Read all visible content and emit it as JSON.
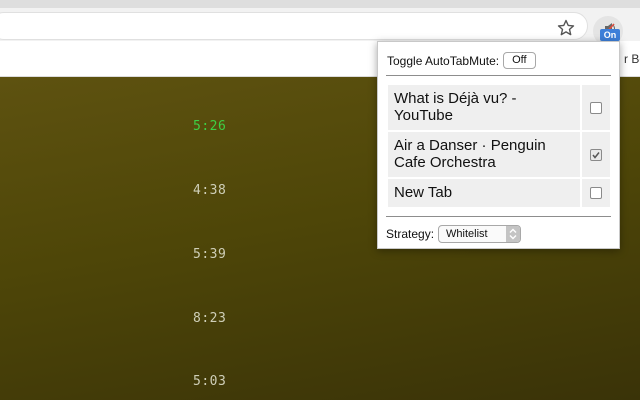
{
  "browser": {
    "bookmark_partial": "r Bo",
    "extension_badge": "On",
    "icons": {
      "star": "star-icon",
      "extension": "muted-speaker-icon"
    }
  },
  "page": {
    "durations": [
      "5:26",
      "4:38",
      "5:39",
      "8:23",
      "5:03"
    ],
    "active_color": "#3ecf44"
  },
  "popup": {
    "toggle_label": "Toggle AutoTabMute:",
    "toggle_button": "Off",
    "tabs": [
      {
        "title": "What is Déjà vu? - YouTube",
        "checked": false
      },
      {
        "title": "Air a Danser · Penguin Cafe Orchestra",
        "checked": true
      },
      {
        "title": "New Tab",
        "checked": false
      }
    ],
    "strategy_label": "Strategy:",
    "strategy_value": "Whitelist"
  }
}
